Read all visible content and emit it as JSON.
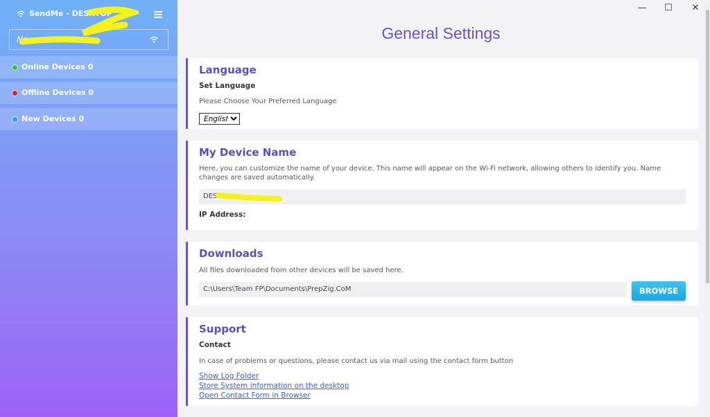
{
  "app": {
    "title": "SendMe - DESKTOP",
    "network_name": "Ne"
  },
  "sidebar": {
    "items": [
      {
        "label": "Online Devices 0",
        "status": "online",
        "color": "#2ecc2e"
      },
      {
        "label": "Offline Devices 0",
        "status": "offline",
        "color": "#e0202a"
      },
      {
        "label": "New Devices 0",
        "status": "new",
        "color": "#2aa6e8"
      }
    ]
  },
  "window": {
    "minimize": "—",
    "maximize": "☐",
    "close": "✕"
  },
  "main": {
    "title": "General Settings",
    "language": {
      "title": "Language",
      "subtitle": "Set Language",
      "description": "Please Choose Your Preferred Language",
      "selected": "English"
    },
    "device_name": {
      "title": "My Device Name",
      "description": "Here, you can customize the name of your device. This name will appear on the Wi-Fi network, allowing others to identify you. Name changes are saved automatically.",
      "value": "DES",
      "ip_label": "IP Address:"
    },
    "downloads": {
      "title": "Downloads",
      "description": "All files downloaded from other devices will be saved here.",
      "path": "C:\\Users\\Team FP\\Documents\\PrepZig.CoM",
      "browse_label": "BROWSE"
    },
    "support": {
      "title": "Support",
      "subtitle": "Contact",
      "description": "In case of problems or questions, please contact us via mail using the contact form button",
      "links": [
        "Show Log Folder",
        "Store System information on the desktop",
        "Open Contact Form in Browser"
      ]
    }
  },
  "colors": {
    "accent": "#6a52c4",
    "button": "#1aa7e2",
    "sidebar_top": "#6fb1f7",
    "sidebar_bottom": "#9d62f5"
  }
}
